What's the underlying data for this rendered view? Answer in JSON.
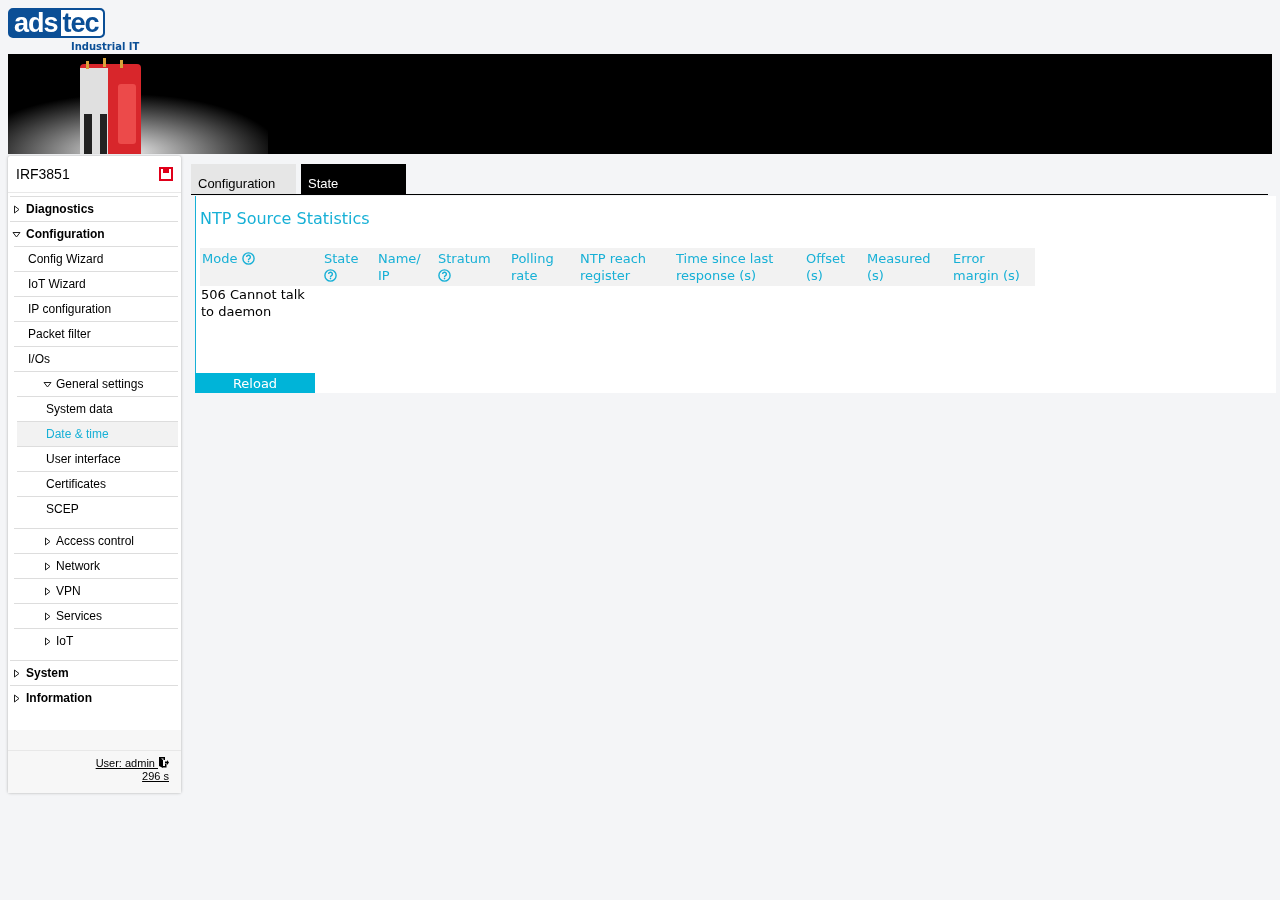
{
  "logo": {
    "left": "ads",
    "right": "tec",
    "tagline": "Industrial IT"
  },
  "sidebar": {
    "device": "IRF3851",
    "items": [
      {
        "label": "Diagnostics",
        "kind": "group",
        "expanded": false,
        "selected": false
      },
      {
        "label": "Configuration",
        "kind": "group",
        "expanded": true,
        "selected": false,
        "children": [
          {
            "label": "Config Wizard",
            "kind": "page",
            "selected": false
          },
          {
            "label": "IoT Wizard",
            "kind": "page",
            "selected": false
          },
          {
            "label": "IP configuration",
            "kind": "page",
            "selected": false
          },
          {
            "label": "Packet filter",
            "kind": "page",
            "selected": false
          },
          {
            "label": "I/Os",
            "kind": "page",
            "selected": false
          },
          {
            "label": "General settings",
            "kind": "group",
            "expanded": true,
            "selected": false,
            "children": [
              {
                "label": "System data",
                "kind": "page",
                "selected": false
              },
              {
                "label": "Date & time",
                "kind": "page",
                "selected": true
              },
              {
                "label": "User interface",
                "kind": "page",
                "selected": false
              },
              {
                "label": "Certificates",
                "kind": "page",
                "selected": false
              },
              {
                "label": "SCEP",
                "kind": "page",
                "selected": false
              }
            ]
          },
          {
            "label": "Access control",
            "kind": "group",
            "expanded": false,
            "selected": false
          },
          {
            "label": "Network",
            "kind": "group",
            "expanded": false,
            "selected": false
          },
          {
            "label": "VPN",
            "kind": "group",
            "expanded": false,
            "selected": false
          },
          {
            "label": "Services",
            "kind": "group",
            "expanded": false,
            "selected": false
          },
          {
            "label": "IoT",
            "kind": "group",
            "expanded": false,
            "selected": false
          }
        ]
      },
      {
        "label": "System",
        "kind": "group",
        "expanded": false,
        "selected": false
      },
      {
        "label": "Information",
        "kind": "group",
        "expanded": false,
        "selected": false
      }
    ],
    "user": "User: admin",
    "timer": "296 s"
  },
  "tabs": [
    {
      "label": "Configuration",
      "selected": false
    },
    {
      "label": "State",
      "selected": true
    }
  ],
  "panel": {
    "title": "NTP Source Statistics",
    "columns": [
      {
        "label": "Mode",
        "help": true
      },
      {
        "label": "State",
        "help": true
      },
      {
        "label": "Name/ IP",
        "help": false
      },
      {
        "label": "Stratum",
        "help": true
      },
      {
        "label": "Polling rate",
        "help": false
      },
      {
        "label": "NTP reach register",
        "help": false
      },
      {
        "label": "Time since last response (s)",
        "help": false
      },
      {
        "label": "Offset (s)",
        "help": false
      },
      {
        "label": "Measured (s)",
        "help": false
      },
      {
        "label": "Error margin (s)",
        "help": false
      }
    ],
    "rows": [
      {
        "cells": [
          "506 Cannot talk to daemon"
        ]
      }
    ],
    "button": "Reload"
  }
}
